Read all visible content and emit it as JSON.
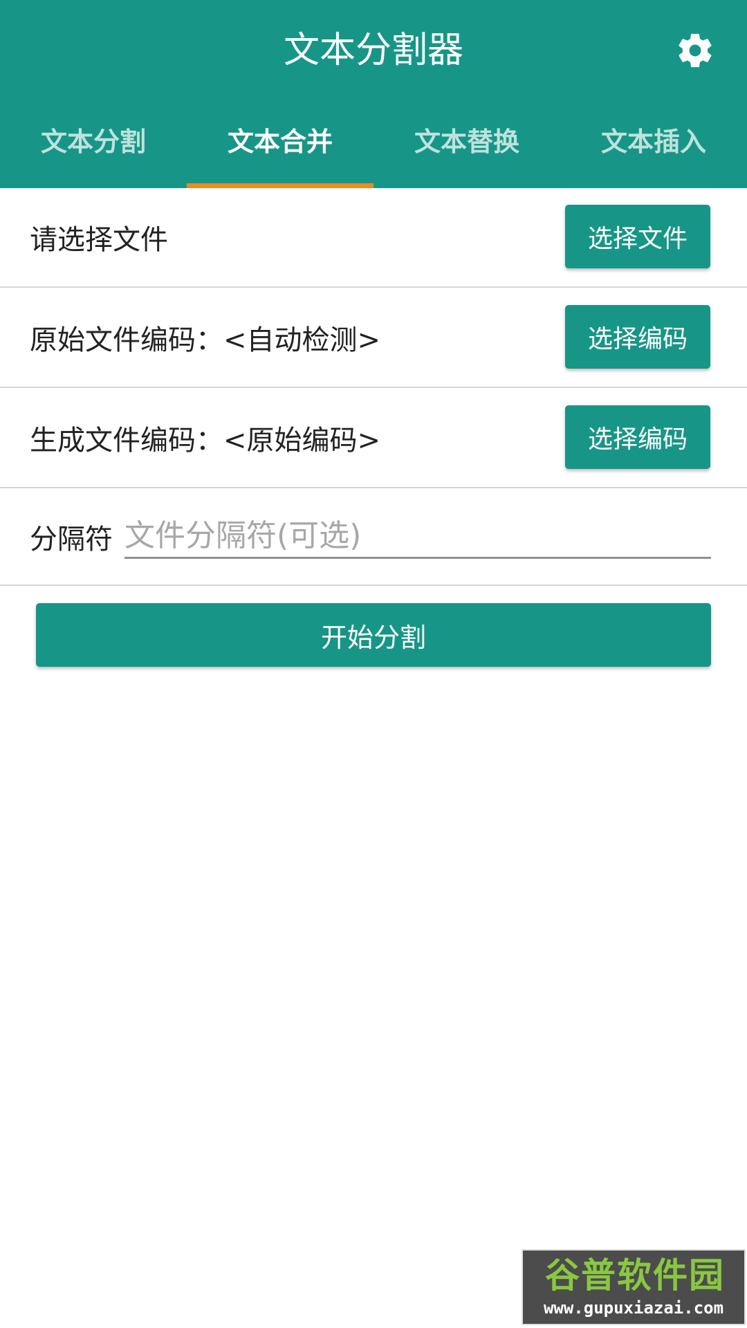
{
  "app": {
    "title": "文本分割器",
    "settings_icon": "gear-icon"
  },
  "tabs": [
    {
      "label": "文本分割",
      "active": false
    },
    {
      "label": "文本合并",
      "active": true
    },
    {
      "label": "文本替换",
      "active": false
    },
    {
      "label": "文本插入",
      "active": false
    }
  ],
  "rows": {
    "file": {
      "label": "请选择文件",
      "button": "选择文件"
    },
    "source_encoding": {
      "label": "原始文件编码：<自动检测>",
      "button": "选择编码"
    },
    "output_encoding": {
      "label": "生成文件编码：<原始编码>",
      "button": "选择编码"
    }
  },
  "separator": {
    "label": "分隔符",
    "placeholder": "文件分隔符(可选)",
    "value": ""
  },
  "start_button": "开始分割",
  "watermark": {
    "title": "谷普软件园",
    "url": "www.gupuxiazai.com"
  },
  "colors": {
    "primary": "#179687",
    "tab_indicator": "#f2891d",
    "divider": "#d6d6d6"
  }
}
